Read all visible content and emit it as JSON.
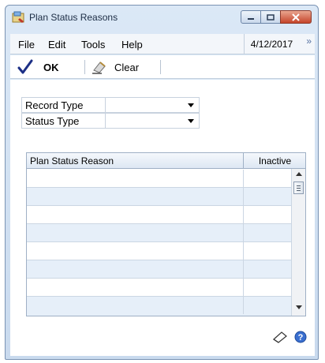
{
  "window": {
    "title": "Plan Status Reasons"
  },
  "menu": {
    "items": [
      "File",
      "Edit",
      "Tools",
      "Help"
    ],
    "date": "4/12/2017",
    "overflow": "»"
  },
  "toolbar": {
    "ok_label": "OK",
    "clear_label": "Clear"
  },
  "form": {
    "record_type_label": "Record Type",
    "record_type_value": "",
    "status_type_label": "Status Type",
    "status_type_value": ""
  },
  "grid": {
    "columns": [
      "Plan Status Reason",
      "Inactive"
    ],
    "rows": [
      {
        "reason": "",
        "inactive": ""
      },
      {
        "reason": "",
        "inactive": ""
      },
      {
        "reason": "",
        "inactive": ""
      },
      {
        "reason": "",
        "inactive": ""
      },
      {
        "reason": "",
        "inactive": ""
      },
      {
        "reason": "",
        "inactive": ""
      },
      {
        "reason": "",
        "inactive": ""
      },
      {
        "reason": "",
        "inactive": ""
      }
    ]
  },
  "icons": {
    "app": "plan-status-app-icon",
    "ok": "checkmark-icon",
    "clear": "eraser-icon",
    "note": "note-icon",
    "help": "help-icon"
  },
  "colors": {
    "window_chrome": "#c9daee",
    "row_alt": "#e6eff9",
    "close_button": "#c5442a"
  }
}
